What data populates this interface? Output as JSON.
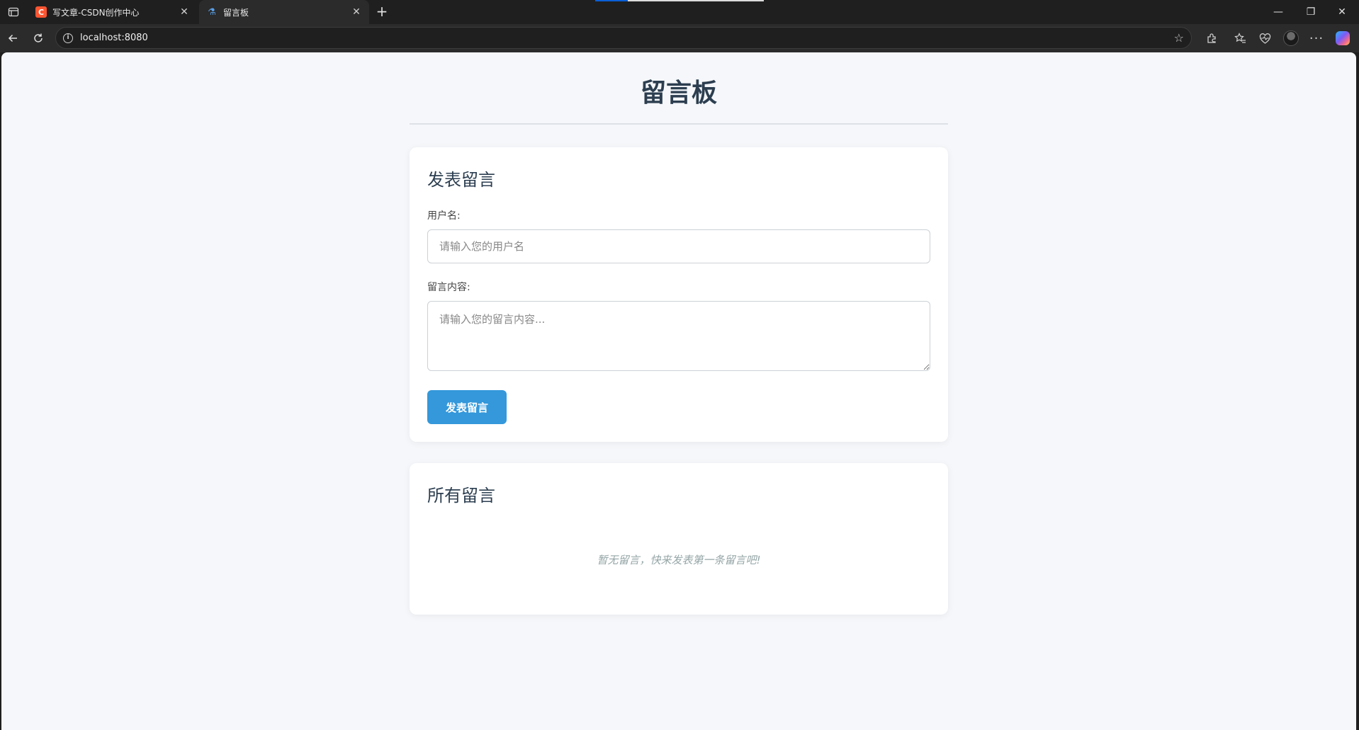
{
  "browser": {
    "tabs": [
      {
        "title": "写文章-CSDN创作中心",
        "favicon": "csdn-logo-icon",
        "active": false
      },
      {
        "title": "留言板",
        "favicon": "page-icon",
        "active": true
      }
    ],
    "new_tab_symbol": "+",
    "url": "localhost:8080",
    "window_controls": {
      "minimize": "—",
      "restore": "❐",
      "close": "✕"
    }
  },
  "page": {
    "title": "留言板",
    "form": {
      "heading": "发表留言",
      "username_label": "用户名:",
      "username_placeholder": "请输入您的用户名",
      "username_value": "",
      "content_label": "留言内容:",
      "content_placeholder": "请输入您的留言内容...",
      "content_value": "",
      "submit_label": "发表留言"
    },
    "list": {
      "heading": "所有留言",
      "empty_text": "暂无留言，快来发表第一条留言吧!"
    }
  },
  "colors": {
    "page_bg": "#f5f7fa",
    "heading": "#2c3e50",
    "accent": "#3498db",
    "empty_text": "#95a5a6",
    "browser_chrome": "#1f1f1f"
  }
}
